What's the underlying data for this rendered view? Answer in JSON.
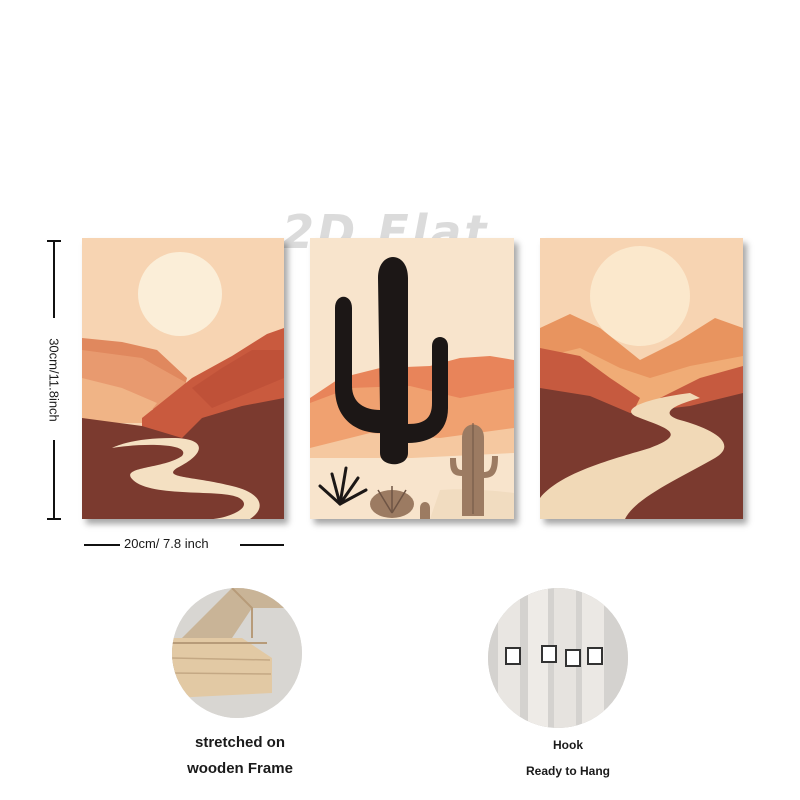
{
  "watermark": "2D Flat",
  "dimensions": {
    "height_label": "30cm/11.8inch",
    "width_label": "20cm/ 7.8 inch"
  },
  "panels": [
    {
      "name": "desert-river-panel"
    },
    {
      "name": "saguaro-cactus-panel"
    },
    {
      "name": "winding-road-panel"
    }
  ],
  "details": [
    {
      "lines": [
        "stretched on",
        "wooden Frame"
      ]
    },
    {
      "lines": [
        "Hook",
        "Ready to Hang"
      ]
    }
  ],
  "colors": {
    "sky": "#f7d4b2",
    "sun": "#fbecd5",
    "rust": "#c65a3f",
    "terracotta": "#e28a5f",
    "brown": "#7a3a2f",
    "cactus": "#1c1716"
  }
}
